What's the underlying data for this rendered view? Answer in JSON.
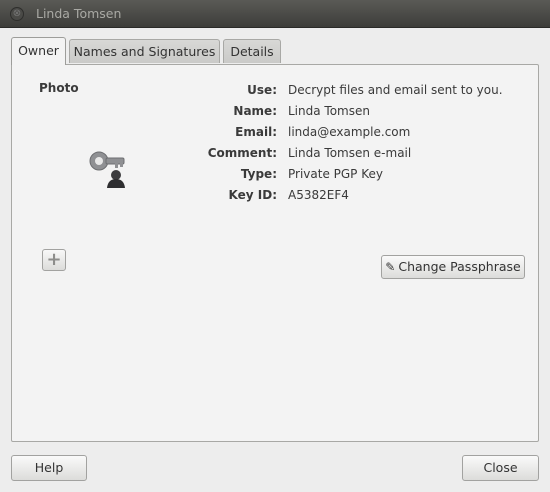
{
  "window": {
    "title": "Linda Tomsen",
    "close_glyph": "⊗"
  },
  "tabs": [
    {
      "label": "Owner",
      "active": true
    },
    {
      "label": "Names and Signatures",
      "active": false
    },
    {
      "label": "Details",
      "active": false
    }
  ],
  "owner": {
    "photo_label": "Photo",
    "photo_icon": "key-icon",
    "add_photo_glyph": "+",
    "rows": [
      {
        "label": "Use:",
        "value": "Decrypt files and email sent to you."
      },
      {
        "label": "Name:",
        "value": "Linda Tomsen"
      },
      {
        "label": "Email:",
        "value": "linda@example.com"
      },
      {
        "label": "Comment:",
        "value": "Linda Tomsen e-mail"
      },
      {
        "label": "Type:",
        "value": "Private PGP Key"
      },
      {
        "label": "Key ID:",
        "value": "A5382EF4"
      }
    ],
    "change_passphrase_label": "Change Passphrase",
    "pencil_glyph": "✎"
  },
  "footer": {
    "help_label": "Help",
    "close_label": "Close"
  }
}
